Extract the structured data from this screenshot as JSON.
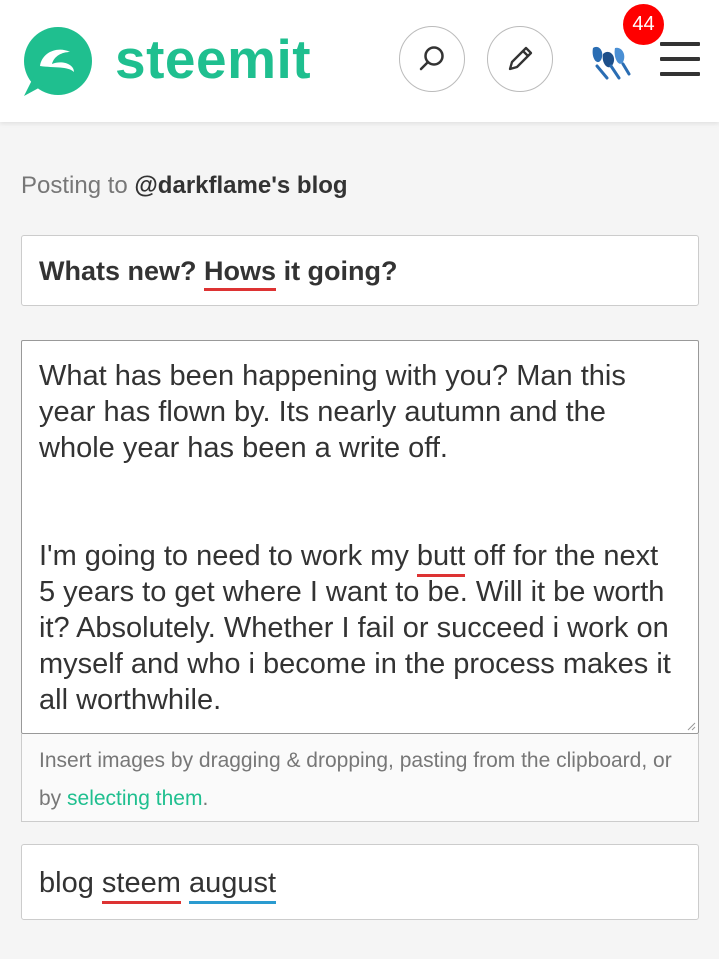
{
  "header": {
    "brand": "steemit",
    "notification_count": "44"
  },
  "posting": {
    "prefix": "Posting to",
    "target": "@darkflame's blog"
  },
  "title_field": {
    "value_part1": "Whats new?",
    "value_misspelled": "Hows",
    "value_part2": "it going?"
  },
  "body_field": {
    "paragraph1": "What has been happening with you? Man this year has flown by. Its nearly autumn and the whole year has been a write off.",
    "paragraph2_before": "I'm going to need to work my",
    "paragraph2_misspelled": "butt",
    "paragraph2_after": "off for the next 5 years to get where I want to be. Will it be worth it? Absolutely. Whether I fail or succeed i work on myself and who i become in the process makes it all worthwhile."
  },
  "dropzone": {
    "text": "Insert images by dragging & dropping, pasting from the clipboard, or by",
    "link": "selecting them",
    "suffix": "."
  },
  "tags_field": {
    "tag1": "blog",
    "tag2": "steem",
    "tag3": "august"
  },
  "colors": {
    "brand": "#1fbf8f",
    "badge": "#ff0000",
    "spell_error": "#d33333",
    "grammar_hint": "#2a9bd0"
  }
}
